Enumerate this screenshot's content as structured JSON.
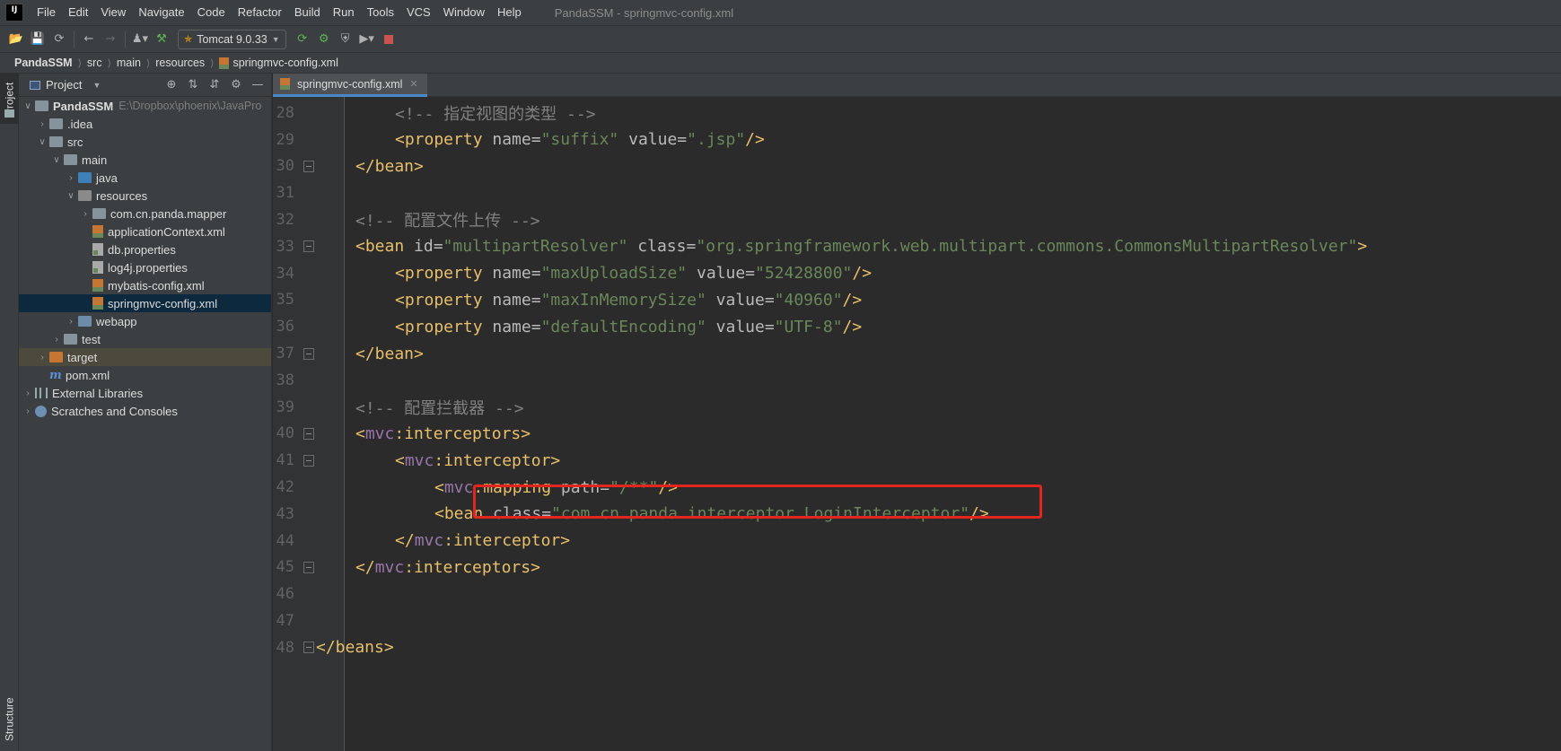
{
  "menubar": {
    "logo": "IJ",
    "items": [
      "File",
      "Edit",
      "View",
      "Navigate",
      "Code",
      "Refactor",
      "Build",
      "Run",
      "Tools",
      "VCS",
      "Window",
      "Help"
    ],
    "window_title": "PandaSSM - springmvc-config.xml"
  },
  "toolbar": {
    "run_config": "Tomcat 9.0.33"
  },
  "breadcrumbs": [
    "PandaSSM",
    "src",
    "main",
    "resources",
    "springmvc-config.xml"
  ],
  "left_strip": {
    "project_tab": "Project",
    "structure_tab": "Structure"
  },
  "project_panel": {
    "title": "Project",
    "tree": [
      {
        "label": "PandaSSM",
        "path": "E:\\Dropbox\\phoenix\\JavaPro"
      },
      {
        "label": ".idea"
      },
      {
        "label": "src"
      },
      {
        "label": "main"
      },
      {
        "label": "java"
      },
      {
        "label": "resources"
      },
      {
        "label": "com.cn.panda.mapper"
      },
      {
        "label": "applicationContext.xml"
      },
      {
        "label": "db.properties"
      },
      {
        "label": "log4j.properties"
      },
      {
        "label": "mybatis-config.xml"
      },
      {
        "label": "springmvc-config.xml"
      },
      {
        "label": "webapp"
      },
      {
        "label": "test"
      },
      {
        "label": "target"
      },
      {
        "label": "pom.xml"
      },
      {
        "label": "External Libraries"
      },
      {
        "label": "Scratches and Consoles"
      }
    ]
  },
  "editor": {
    "tab": "springmvc-config.xml",
    "line_numbers": [
      "28",
      "29",
      "30",
      "31",
      "32",
      "33",
      "34",
      "35",
      "36",
      "37",
      "38",
      "39",
      "40",
      "41",
      "42",
      "43",
      "44",
      "45",
      "46",
      "47",
      "48"
    ],
    "comments": {
      "view_type": "<!-- 指定视图的类型 -->",
      "upload": "<!-- 配置文件上传 -->",
      "interceptor": "<!-- 配置拦截器 -->"
    },
    "tokens": {
      "property_open": "<property",
      "name_attr": " name=",
      "value_attr": " value=",
      "self_close": "/>",
      "bean_close": "</bean>",
      "bean_open": "<bean",
      "id_attr": " id=",
      "class_attr": " class=",
      "close_angle": ">",
      "lt": "<",
      "lt_slash": "</",
      "mvc": "mvc",
      "colon_interceptors": ":interceptors",
      "colon_interceptor": ":interceptor",
      "colon_mapping": ":mapping",
      "path_attr": " path=",
      "beans_close": "</beans>"
    },
    "values": {
      "suffix": "\"suffix\"",
      "jsp": "\".jsp\"",
      "multipartResolver": "\"multipartResolver\"",
      "resolver_class": "\"org.springframework.web.multipart.commons.CommonsMultipartResolver\"",
      "maxUploadSize": "\"maxUploadSize\"",
      "maxUploadSize_val": "\"52428800\"",
      "maxInMemorySize": "\"maxInMemorySize\"",
      "maxInMemorySize_val": "\"40960\"",
      "defaultEncoding": "\"defaultEncoding\"",
      "defaultEncoding_val": "\"UTF-8\"",
      "mapping_path": "\"/**\"",
      "interceptor_class": "\"com.cn.panda.interceptor.LoginInterceptor\""
    }
  }
}
